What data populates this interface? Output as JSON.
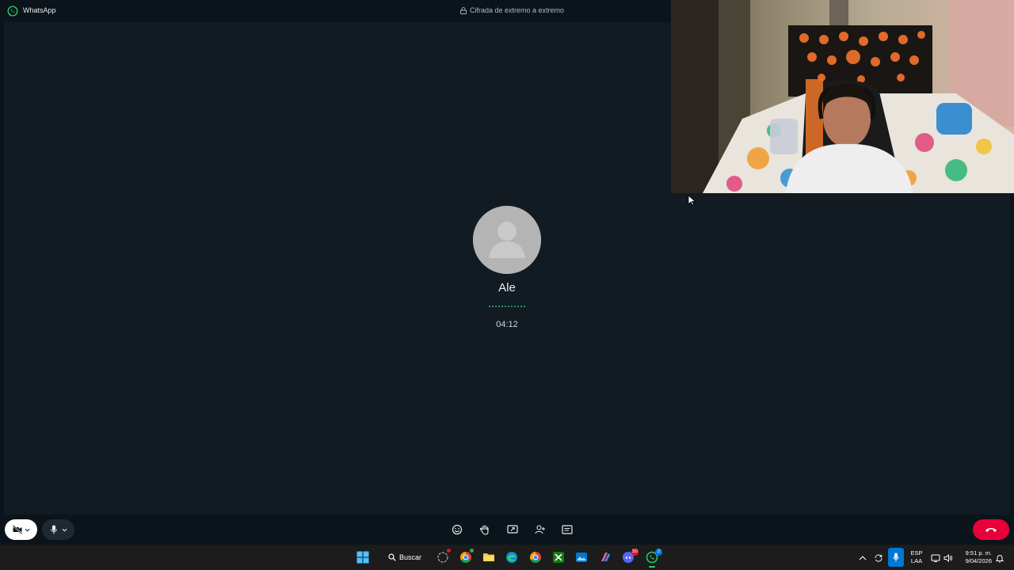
{
  "titlebar": {
    "app_name": "WhatsApp",
    "encryption_text": "Cifrada de extremo a extremo"
  },
  "call": {
    "contact_name": "Ale",
    "duration": "04:12"
  },
  "icons": {
    "app_logo": "whatsapp-logo-icon",
    "lock": "lock-icon",
    "avatar": "default-person-avatar",
    "video_off": "video-off-icon",
    "mic": "microphone-icon",
    "reactions": "emoji-icon",
    "raise_hand": "raise-hand-icon",
    "share_screen": "share-screen-icon",
    "add_participant": "add-person-icon",
    "chat": "chat-icon",
    "end_call": "end-call-icon"
  },
  "taskbar": {
    "search_label": "Buscar",
    "apps": [
      {
        "name": "start-button",
        "color": "#4cc2ff"
      },
      {
        "name": "copilot",
        "badge": "",
        "badge_color": "#e81123"
      },
      {
        "name": "chrome-profile",
        "badge": "",
        "badge_color": "#3aa757"
      },
      {
        "name": "file-explorer"
      },
      {
        "name": "edge"
      },
      {
        "name": "chrome"
      },
      {
        "name": "xbox"
      },
      {
        "name": "photos"
      },
      {
        "name": "microsoft-365"
      },
      {
        "name": "discord",
        "badge": "50",
        "badge_color": "#e81123"
      },
      {
        "name": "whatsapp",
        "badge": "2",
        "badge_color": "#0078d4"
      }
    ],
    "language_line1": "ESP",
    "language_line2": "LAA",
    "time": "9:51 p. m.",
    "date": "9/04/2026"
  },
  "colors": {
    "background": "#0b141a",
    "call_area": "#111b21",
    "accent_green": "#25d366",
    "end_call_red": "#ea0038",
    "taskbar": "#1c1c1c"
  }
}
